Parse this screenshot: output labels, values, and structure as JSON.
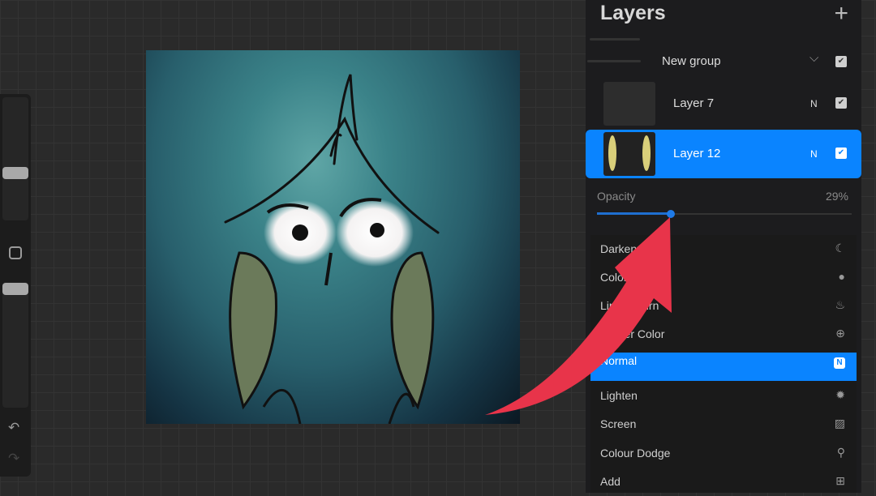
{
  "panel": {
    "title": "Layers",
    "add_icon": "plus-icon",
    "group": {
      "name": "New group",
      "visible": true
    },
    "layers": [
      {
        "name": "Layer 7",
        "blend": "N",
        "visible": true,
        "selected": false
      },
      {
        "name": "Layer 12",
        "blend": "N",
        "visible": true,
        "selected": true
      }
    ],
    "opacity": {
      "label": "Opacity",
      "value_text": "29%",
      "value": 29
    }
  },
  "blend_modes": [
    {
      "label": "Darken",
      "icon": "moon-icon"
    },
    {
      "label": "Color Burn",
      "icon": "burn-icon"
    },
    {
      "label": "Linear Burn",
      "icon": "flame-icon"
    },
    {
      "label": "Darker Color",
      "icon": "plus-circle-icon"
    },
    {
      "label": "Normal",
      "icon": "n-badge-icon",
      "badge": "N",
      "selected": true
    },
    {
      "label": "Lighten",
      "icon": "sun-icon"
    },
    {
      "label": "Screen",
      "icon": "hatch-icon"
    },
    {
      "label": "Colour Dodge",
      "icon": "dodge-icon"
    },
    {
      "label": "Add",
      "icon": "plus-square-icon"
    }
  ],
  "colors": {
    "accent": "#0a84ff",
    "arrow": "#e8344a"
  }
}
